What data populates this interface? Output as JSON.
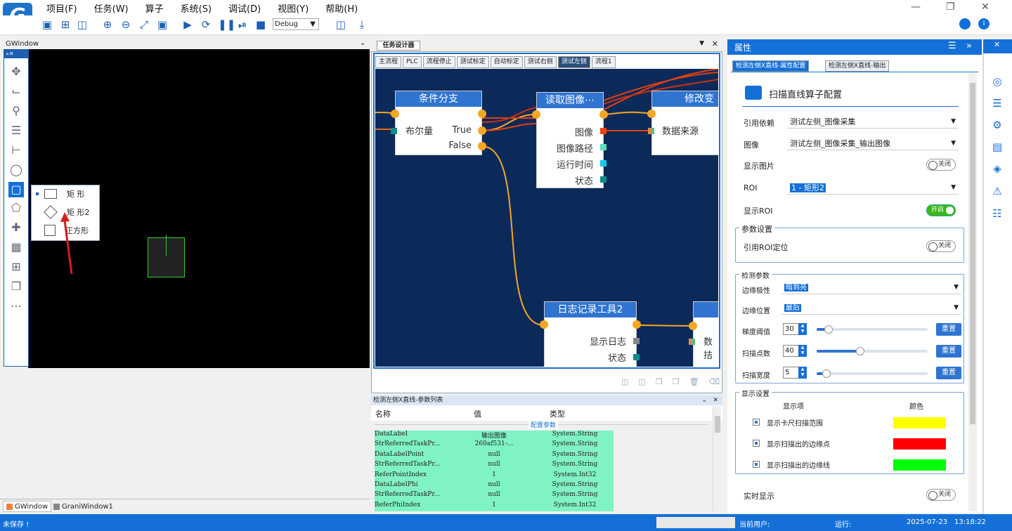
{
  "app": {
    "logo": "G"
  },
  "menu": [
    "项目(F)",
    "任务(W)",
    "算子",
    "系统(S)",
    "调试(D)",
    "视图(Y)",
    "帮助(H)"
  ],
  "toolbar": {
    "mode": "Debug"
  },
  "gwindow": {
    "title": "GWindow",
    "shape_menu": [
      {
        "label": "矩 形"
      },
      {
        "label": "矩 形2"
      },
      {
        "label": "正方形"
      }
    ],
    "bottom_tabs": [
      "GWindow",
      "GraniWindow1"
    ]
  },
  "task_designer": {
    "title": "任务设计器",
    "tabs": [
      "主流程",
      "PLC",
      "流程停止",
      "测试标定",
      "自动标定",
      "测试右侧",
      "测试左侧",
      "流程1"
    ],
    "active_tab": "测试左侧",
    "nodes": {
      "branch": {
        "title": "条件分支",
        "input": "布尔量",
        "out_true": "True",
        "out_false": "False"
      },
      "readimg": {
        "title": "读取图像⋯",
        "rows": [
          "图像",
          "图像路径",
          "运行时间",
          "状态"
        ]
      },
      "modify": {
        "title": "修改变",
        "row": "数据来源"
      },
      "log": {
        "title": "日志记录工具2",
        "rows": [
          "显示日志",
          "状态"
        ]
      },
      "extra": {
        "row": "数拮"
      }
    }
  },
  "param_list": {
    "title": "检测左侧X直线-参数列表",
    "headers": [
      "名称",
      "值",
      "类型"
    ],
    "section": "配置参数",
    "rows": [
      [
        "DataLabel",
        "输出图像",
        "System.String"
      ],
      [
        "StrReferredTaskPr...",
        "260af531-...",
        "System.String"
      ],
      [
        "DataLabelPoint",
        "null",
        "System.String"
      ],
      [
        "StrReferredTaskPr...",
        "null",
        "System.String"
      ],
      [
        "ReferPointIndex",
        "1",
        "System.Int32"
      ],
      [
        "DataLabelPhi",
        "null",
        "System.String"
      ],
      [
        "StrReferredTaskPr...",
        "null",
        "System.String"
      ],
      [
        "ReferPhiIndex",
        "1",
        "System.Int32"
      ]
    ]
  },
  "properties": {
    "title": "属性",
    "tabs": [
      "检测左侧X直线-属性配置",
      "检测左侧X直线-输出"
    ],
    "heading": "扫描直线算子配置",
    "ref_dep_label": "引用依赖",
    "ref_dep_value": "测试左侧_图像采集",
    "image_label": "图像",
    "image_value": "测试左侧_图像采集_输出图像",
    "show_image_label": "显示图片",
    "show_image_state": "关闭",
    "roi_label": "ROI",
    "roi_value": "1 - 矩形2",
    "show_roi_label": "显示ROI",
    "show_roi_state": "开启",
    "param_group": "参数设置",
    "ref_roi_label": "引用ROI定位",
    "ref_roi_state": "关闭",
    "detect_group": "检测参数",
    "polarity_label": "边缘极性",
    "polarity_value": "暗到亮",
    "position_label": "边缘位置",
    "position_value": "最后",
    "gradient_label": "梯度阈值",
    "gradient_value": "30",
    "gradient_level": 0.11,
    "points_label": "扫描点数",
    "points_value": "40",
    "points_level": 0.39,
    "width_label": "扫描宽度",
    "width_value": "5",
    "width_level": 0.09,
    "reset_label": "重置",
    "display_group": "显示设置",
    "col_item": "显示项",
    "col_color": "颜色",
    "display_items": [
      {
        "label": "显示卡尺扫描范围",
        "color": "#ffff00"
      },
      {
        "label": "显示扫描出的边缘点",
        "color": "#ff0000"
      },
      {
        "label": "显示扫描出的边缘线",
        "color": "#00ff00"
      }
    ],
    "realtime_label": "实时显示",
    "realtime_state": "关闭"
  },
  "status": {
    "save": "未保存 !",
    "user_label": "当前用户:",
    "run_label": "运行:",
    "date": "2025-07-23",
    "time": "13:18:22"
  }
}
